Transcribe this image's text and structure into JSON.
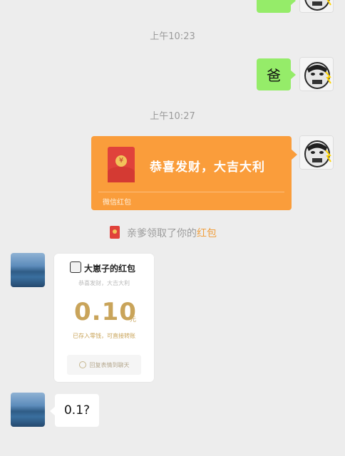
{
  "chat": {
    "timestamp_1": "上午10:23",
    "timestamp_2": "上午10:27",
    "msg_sent_1": "爸",
    "red_packet": {
      "title": "恭喜发财，大吉大利",
      "footer": "微信红包",
      "accent_color": "#fa9d3b"
    },
    "system_notice": {
      "prefix": "亲爹领取了你的",
      "highlight": "红包",
      "icon": "red-packet-icon"
    },
    "received_packet": {
      "title": "大崽子的红包",
      "subtitle": "恭喜发财，大吉大利",
      "amount": "0.10",
      "unit": "元",
      "note": "已存入零钱，可直接转账",
      "reply_button": "回复表情到聊天",
      "amount_color": "#c9a45a"
    },
    "msg_received_last": "0.1?"
  }
}
